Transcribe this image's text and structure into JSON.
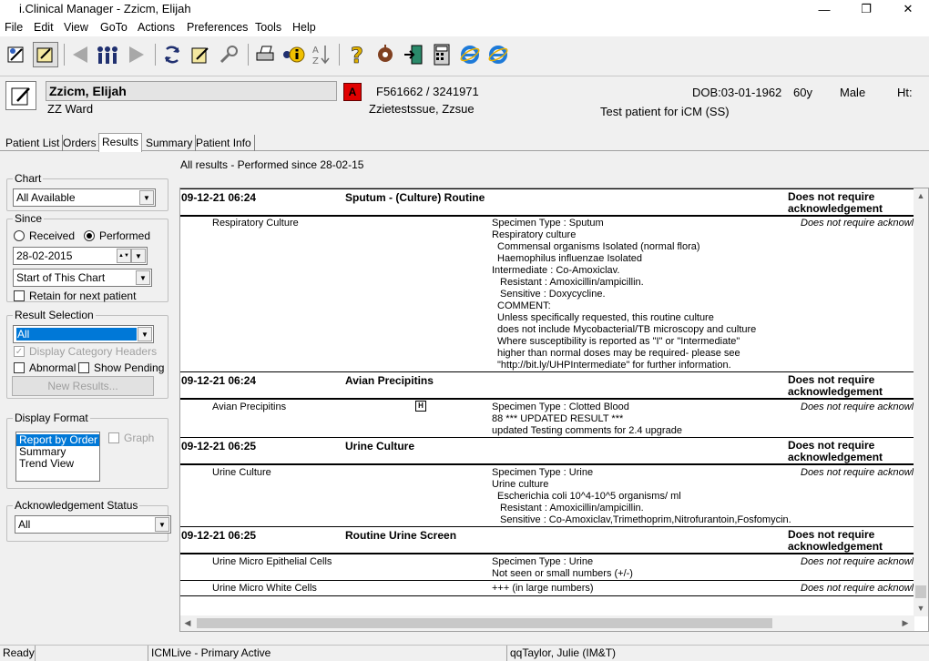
{
  "window": {
    "title": "i.Clinical Manager - Zzicm, Elijah"
  },
  "menu": [
    "File",
    "Edit",
    "View",
    "GoTo",
    "Actions",
    "Preferences",
    "Tools",
    "Help"
  ],
  "patient": {
    "name": "Zzicm, Elijah",
    "ward": "ZZ Ward",
    "alert": "A",
    "ids": "F561662 / 3241971",
    "consultant": "Zzietestssue, Zzsue",
    "dob": "DOB:03-01-1962",
    "age": "60y",
    "sex": "Male",
    "ht": "Ht:",
    "note": "Test patient for iCM (SS)"
  },
  "tabs": [
    "Patient List",
    "Orders",
    "Results",
    "Summary",
    "Patient Info"
  ],
  "left": {
    "chart_label": "Chart",
    "chart_value": "All Available",
    "since_label": "Since",
    "received_label": "Received",
    "performed_label": "Performed",
    "date_value": "28-02-2015",
    "start_value": "Start of This Chart",
    "retain_label": "Retain for next patient",
    "result_selection_label": "Result Selection",
    "result_selection_value": "All",
    "display_headers_label": "Display Category Headers",
    "abnormal_label": "Abnormal",
    "show_pending_label": "Show Pending",
    "new_results_label": "New Results...",
    "display_format_label": "Display Format",
    "format_options": [
      "Report by Order",
      "Summary",
      "Trend View"
    ],
    "graph_label": "Graph",
    "ack_label": "Acknowledgement Status",
    "ack_value": "All"
  },
  "results": {
    "heading": "All results - Performed since 28-02-15",
    "orders": [
      {
        "datetime": "09-12-21 06:24",
        "name": "Sputum - (Culture) Routine",
        "ack": "Does not require acknowledgement",
        "tests": [
          {
            "name": "Respiratory Culture",
            "lines": [
              "Specimen Type : Sputum",
              "Respiratory culture",
              "  Commensal organisms Isolated (normal flora)",
              "  Haemophilus influenzae Isolated",
              "Intermediate : Co-Amoxiclav.",
              "   Resistant : Amoxicillin/ampicillin.",
              "   Sensitive : Doxycycline.",
              "  COMMENT:",
              "  Unless specifically requested, this routine culture",
              "  does not include Mycobacterial/TB microscopy and culture",
              "  Where susceptibility is reported as \"I\" or \"Intermediate\"",
              "  higher than normal doses may be required- please see",
              "  \"http://bit.ly/UHPIntermediate\" for further information."
            ],
            "ack": "Does not require acknowl"
          }
        ]
      },
      {
        "datetime": "09-12-21 06:24",
        "name": "Avian Precipitins",
        "ack": "Does not require acknowledgement",
        "tests": [
          {
            "name": "Avian Precipitins",
            "flag": "H",
            "lines": [
              "Specimen Type : Clotted Blood",
              "88 *** UPDATED RESULT ***",
              "updated Testing comments for 2.4 upgrade"
            ],
            "ack": "Does not require acknowl"
          }
        ]
      },
      {
        "datetime": "09-12-21 06:25",
        "name": "Urine Culture",
        "ack": "Does not require acknowledgement",
        "tests": [
          {
            "name": "Urine Culture",
            "lines": [
              "Specimen Type : Urine",
              "Urine culture",
              "  Escherichia coli 10^4-10^5 organisms/ ml",
              "   Resistant : Amoxicillin/ampicillin.",
              "   Sensitive : Co-Amoxiclav,Trimethoprim,Nitrofurantoin,Fosfomycin."
            ],
            "ack": "Does not require acknowl"
          }
        ]
      },
      {
        "datetime": "09-12-21 06:25",
        "name": "Routine Urine Screen",
        "ack": "Does not require acknowledgement",
        "tests": [
          {
            "name": "Urine Micro Epithelial Cells",
            "lines": [
              "Specimen Type : Urine",
              "Not seen or small numbers (+/-)"
            ],
            "ack": "Does not require acknowl"
          },
          {
            "name": "Urine Micro White Cells",
            "lines": [
              "+++ (in large numbers)"
            ],
            "ack": "Does not require acknowl"
          }
        ]
      }
    ]
  },
  "status": {
    "ready": "Ready",
    "env": "ICMLive - Primary Active",
    "user": "qqTaylor, Julie (IM&T)"
  }
}
